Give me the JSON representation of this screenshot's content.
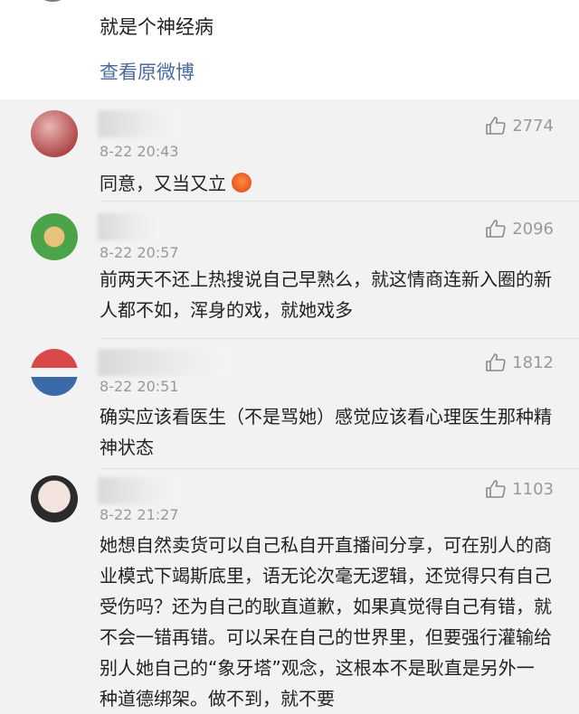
{
  "top": {
    "text": "就是个神经病",
    "link": "查看原微博"
  },
  "comments": [
    {
      "time": "8-22 20:43",
      "likes": "2774",
      "text": "同意，又当又立"
    },
    {
      "time": "8-22 20:57",
      "likes": "2096",
      "text": "前两天不还上热搜说自己早熟么，就这情商连新入圈的新人都不如，浑身的戏，就她戏多"
    },
    {
      "time": "8-22 20:51",
      "likes": "1812",
      "text": "确实应该看医生（不是骂她）感觉应该看心理医生那种精神状态"
    },
    {
      "time": "8-22 21:27",
      "likes": "1103",
      "text": "她想自然卖货可以自己私自开直播间分享，可在别人的商业模式下竭斯底里，语无论次毫无逻辑，还觉得只有自己受伤吗？还为自己的耿直道歉，如果真觉得自己有错，就不会一错再错。可以呆在自己的世界里，但要强行灌输给别人她自己的“象牙塔”观念，这根本不是耿直是另外一种道德绑架。做不到，就不要"
    }
  ],
  "icons": {
    "like": "thumbs-up-icon",
    "emoji": "angry-face-emoji"
  },
  "colors": {
    "link": "#4a6a9a",
    "meta": "#999999",
    "text": "#222222"
  }
}
